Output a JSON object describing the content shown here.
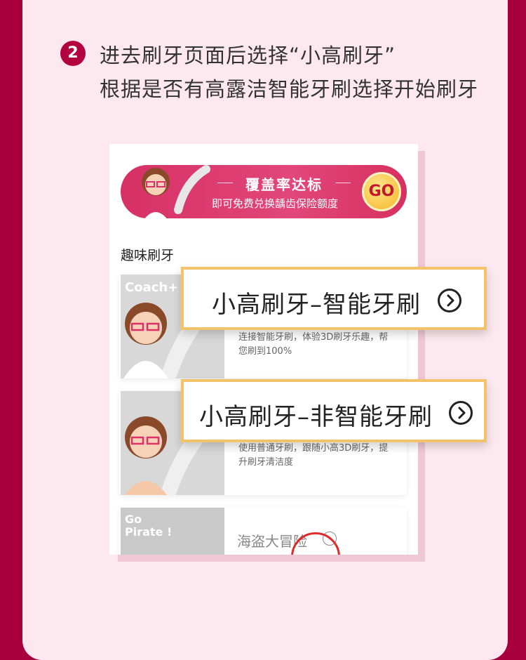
{
  "step": {
    "number": "2",
    "line1": "进去刷牙页面后选择“小高刷牙”",
    "line2": "根据是否有高露洁智能牙刷选择开始刷牙"
  },
  "banner": {
    "title": "覆盖率达标",
    "subtitle": "即可免费兑换龋齿保险额度",
    "go_label": "GO"
  },
  "section": {
    "title": "趣味刷牙"
  },
  "cards": [
    {
      "image_label": "Coach+",
      "description": "连接智能牙刷，体验3D刷牙乐趣，帮您刷到100%"
    },
    {
      "image_label": "",
      "description": "使用普通牙刷，跟随小高3D刷牙，提升刷牙清洁度"
    },
    {
      "image_label": "Go Pirate !",
      "title": "海盗大冒险"
    }
  ],
  "callouts": [
    {
      "label": "小高刷牙–智能牙刷"
    },
    {
      "label": "小高刷牙–非智能牙刷"
    }
  ],
  "colors": {
    "frame": "#a8003c",
    "panel": "#fce8ee",
    "accent": "#b3003f",
    "callout_border": "#f2c36b"
  }
}
